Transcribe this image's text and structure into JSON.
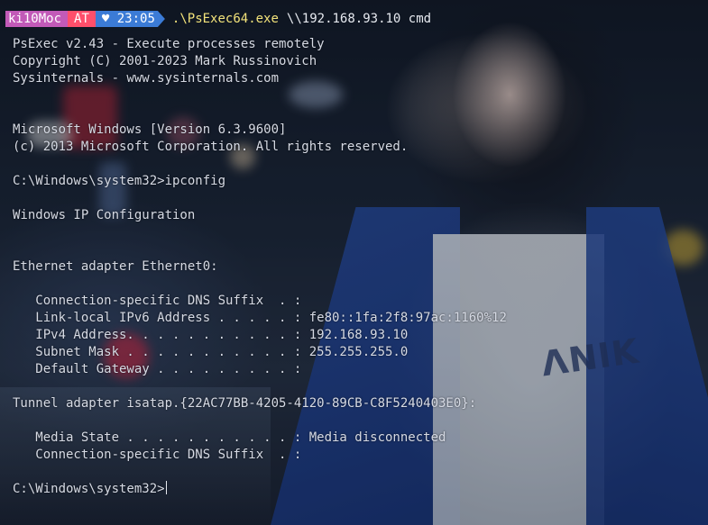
{
  "prompt": {
    "user": "ki10Moc",
    "host": "AT",
    "heart": "♥",
    "time": "23:05",
    "command": ".\\PsExec64.exe",
    "arguments": "\\\\192.168.93.10 cmd"
  },
  "colors": {
    "user_segment": "#c25ab8",
    "host_segment": "#ff4f6b",
    "time_segment": "#3b7bd6",
    "command_text": "#f2e27a"
  },
  "output": {
    "lines": [
      "PsExec v2.43 - Execute processes remotely",
      "Copyright (C) 2001-2023 Mark Russinovich",
      "Sysinternals - www.sysinternals.com",
      "",
      "",
      "Microsoft Windows [Version 6.3.9600]",
      "(c) 2013 Microsoft Corporation. All rights reserved.",
      "",
      "C:\\Windows\\system32>ipconfig",
      "",
      "Windows IP Configuration",
      "",
      "",
      "Ethernet adapter Ethernet0:",
      "",
      "   Connection-specific DNS Suffix  . :",
      "   Link-local IPv6 Address . . . . . : fe80::1fa:2f8:97ac:1160%12",
      "   IPv4 Address. . . . . . . . . . . : 192.168.93.10",
      "   Subnet Mask . . . . . . . . . . . : 255.255.255.0",
      "   Default Gateway . . . . . . . . . :",
      "",
      "Tunnel adapter isatap.{22AC77BB-4205-4120-89CB-C8F5240403E0}:",
      "",
      "   Media State . . . . . . . . . . . : Media disconnected",
      "   Connection-specific DNS Suffix  . :"
    ],
    "final_prompt": "C:\\Windows\\system32>"
  }
}
